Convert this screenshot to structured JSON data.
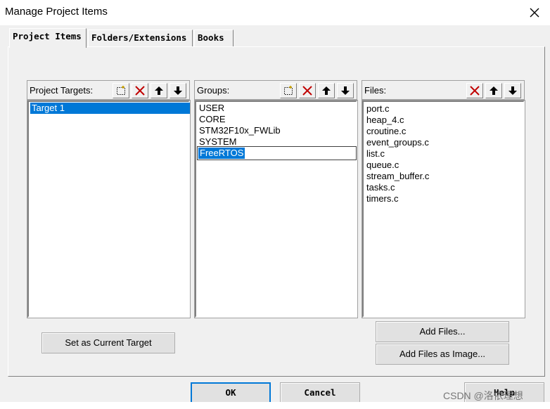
{
  "window": {
    "title": "Manage Project Items"
  },
  "tabs": [
    {
      "label": "Project Items",
      "active": true
    },
    {
      "label": "Folders/Extensions",
      "active": false
    },
    {
      "label": "Books",
      "active": false
    }
  ],
  "targets": {
    "label": "Project Targets:",
    "items": [
      "Target 1"
    ],
    "selected": "Target 1"
  },
  "groups": {
    "label": "Groups:",
    "items": [
      "USER",
      "CORE",
      "STM32F10x_FWLib",
      "SYSTEM",
      "FreeRTOS"
    ],
    "selected": "FreeRTOS"
  },
  "files": {
    "label": "Files:",
    "items": [
      "port.c",
      "heap_4.c",
      "croutine.c",
      "event_groups.c",
      "list.c",
      "queue.c",
      "stream_buffer.c",
      "tasks.c",
      "timers.c"
    ]
  },
  "buttons": {
    "set_current": "Set as Current Target",
    "add_files": "Add Files...",
    "add_files_image": "Add Files as Image...",
    "ok": "OK",
    "cancel": "Cancel",
    "help": "Help"
  },
  "watermark": "CSDN @洛依理想",
  "colors": {
    "selection": "#0078d7",
    "delete_icon": "#c00000",
    "dialog_bg": "#f0f0f0"
  },
  "icons": {
    "new": "new-item-icon",
    "delete": "delete-x-icon",
    "up": "move-up-arrow-icon",
    "down": "move-down-arrow-icon",
    "close": "close-icon"
  }
}
